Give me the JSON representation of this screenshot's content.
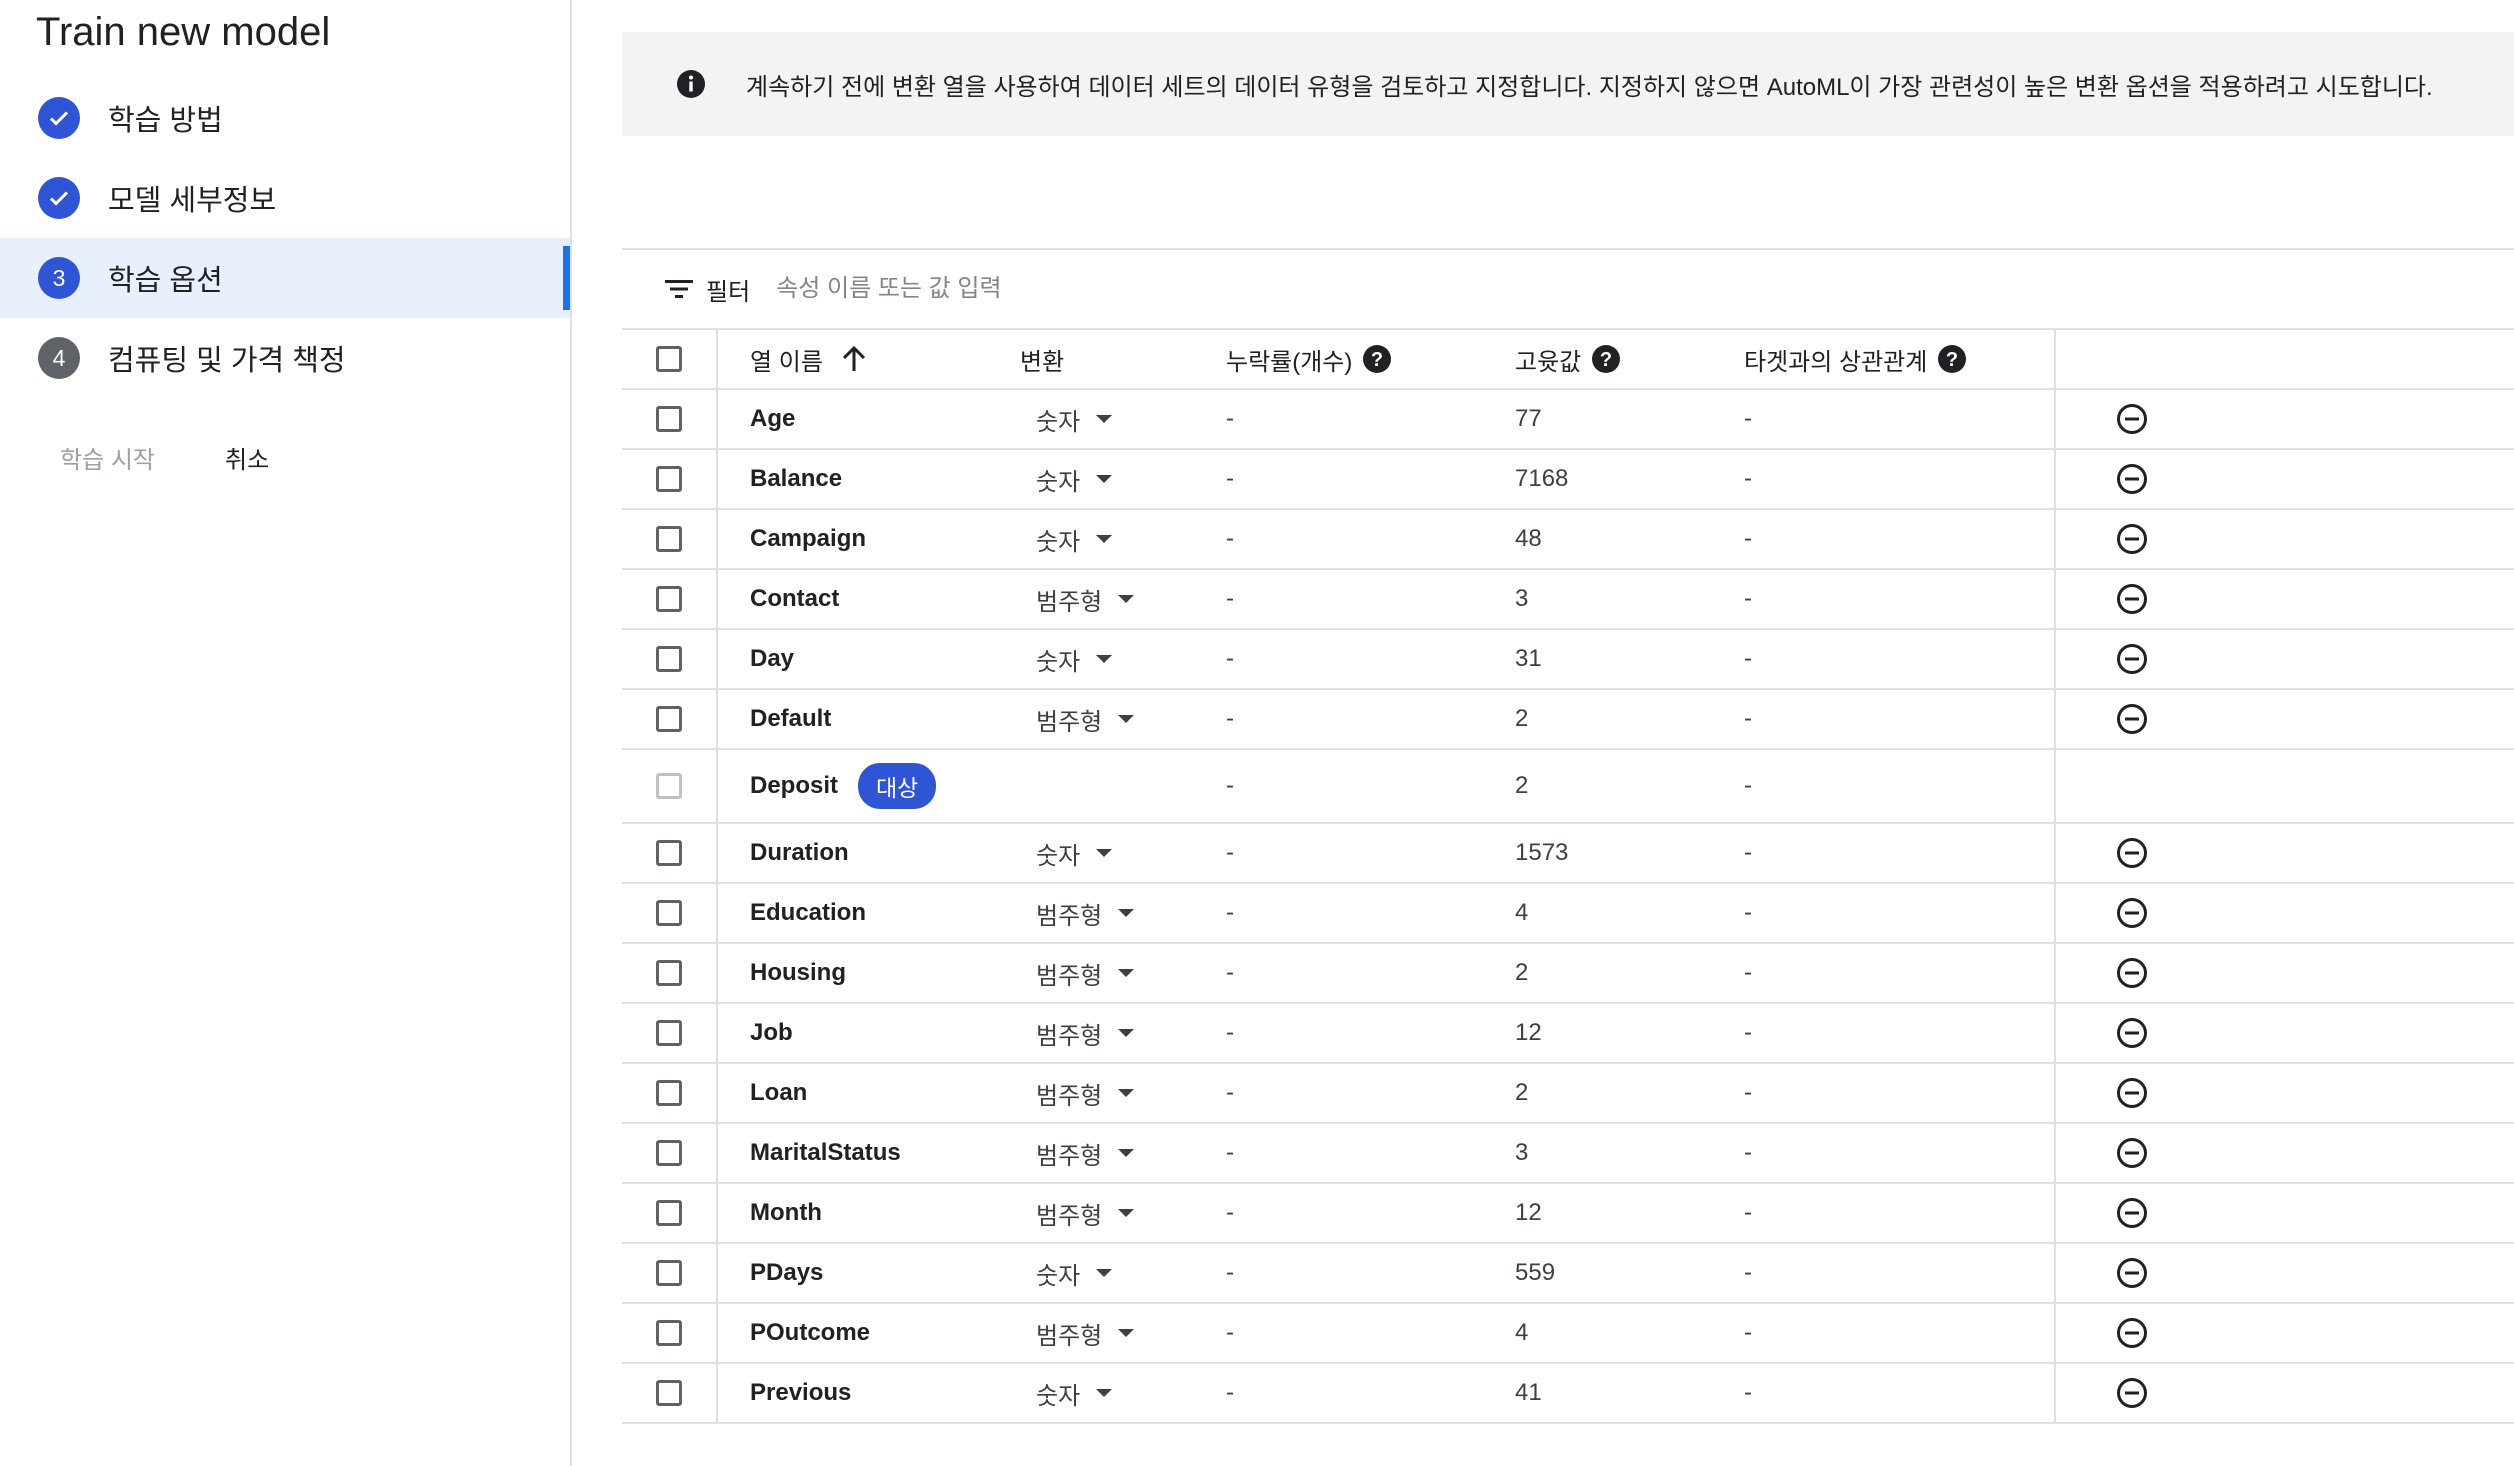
{
  "sidebar": {
    "title": "Train new model",
    "steps": [
      {
        "number": "",
        "label": "학습 방법",
        "state": "done"
      },
      {
        "number": "",
        "label": "모델 세부정보",
        "state": "done"
      },
      {
        "number": "3",
        "label": "학습 옵션",
        "state": "current"
      },
      {
        "number": "4",
        "label": "컴퓨팅 및 가격 책정",
        "state": "todo"
      }
    ],
    "start_label": "학습 시작",
    "cancel_label": "취소"
  },
  "info": {
    "icon": "info-icon",
    "text": "계속하기 전에 변환 열을 사용하여 데이터 세트의 데이터 유형을 검토하고 지정합니다. 지정하지 않으면 AutoML이 가장 관련성이 높은 변환 옵션을 적용하려고 시도합니다."
  },
  "filter": {
    "label": "필터",
    "placeholder": "속성 이름 또는 값 입력"
  },
  "table": {
    "headers": {
      "name": "열 이름",
      "transformation": "변환",
      "missing": "누락률(개수)",
      "unique": "고윳값",
      "correlation": "타겟과의 상관관계"
    },
    "rows": [
      {
        "name": "Age",
        "transformation": "숫자",
        "missing": "-",
        "unique": "77",
        "correlation": "-"
      },
      {
        "name": "Balance",
        "transformation": "숫자",
        "missing": "-",
        "unique": "7168",
        "correlation": "-"
      },
      {
        "name": "Campaign",
        "transformation": "숫자",
        "missing": "-",
        "unique": "48",
        "correlation": "-"
      },
      {
        "name": "Contact",
        "transformation": "범주형",
        "missing": "-",
        "unique": "3",
        "correlation": "-"
      },
      {
        "name": "Day",
        "transformation": "숫자",
        "missing": "-",
        "unique": "31",
        "correlation": "-"
      },
      {
        "name": "Default",
        "transformation": "범주형",
        "missing": "-",
        "unique": "2",
        "correlation": "-"
      },
      {
        "name": "Deposit",
        "transformation": "",
        "badge": "대상",
        "missing": "-",
        "unique": "2",
        "correlation": "-"
      },
      {
        "name": "Duration",
        "transformation": "숫자",
        "missing": "-",
        "unique": "1573",
        "correlation": "-"
      },
      {
        "name": "Education",
        "transformation": "범주형",
        "missing": "-",
        "unique": "4",
        "correlation": "-"
      },
      {
        "name": "Housing",
        "transformation": "범주형",
        "missing": "-",
        "unique": "2",
        "correlation": "-"
      },
      {
        "name": "Job",
        "transformation": "범주형",
        "missing": "-",
        "unique": "12",
        "correlation": "-"
      },
      {
        "name": "Loan",
        "transformation": "범주형",
        "missing": "-",
        "unique": "2",
        "correlation": "-"
      },
      {
        "name": "MaritalStatus",
        "transformation": "범주형",
        "missing": "-",
        "unique": "3",
        "correlation": "-"
      },
      {
        "name": "Month",
        "transformation": "범주형",
        "missing": "-",
        "unique": "12",
        "correlation": "-"
      },
      {
        "name": "PDays",
        "transformation": "숫자",
        "missing": "-",
        "unique": "559",
        "correlation": "-"
      },
      {
        "name": "POutcome",
        "transformation": "범주형",
        "missing": "-",
        "unique": "4",
        "correlation": "-"
      },
      {
        "name": "Previous",
        "transformation": "숫자",
        "missing": "-",
        "unique": "41",
        "correlation": "-"
      }
    ]
  },
  "colors": {
    "accent": "#2f55d4",
    "active_bg": "#e8f0fe",
    "info_bg": "#f1f3f4"
  }
}
